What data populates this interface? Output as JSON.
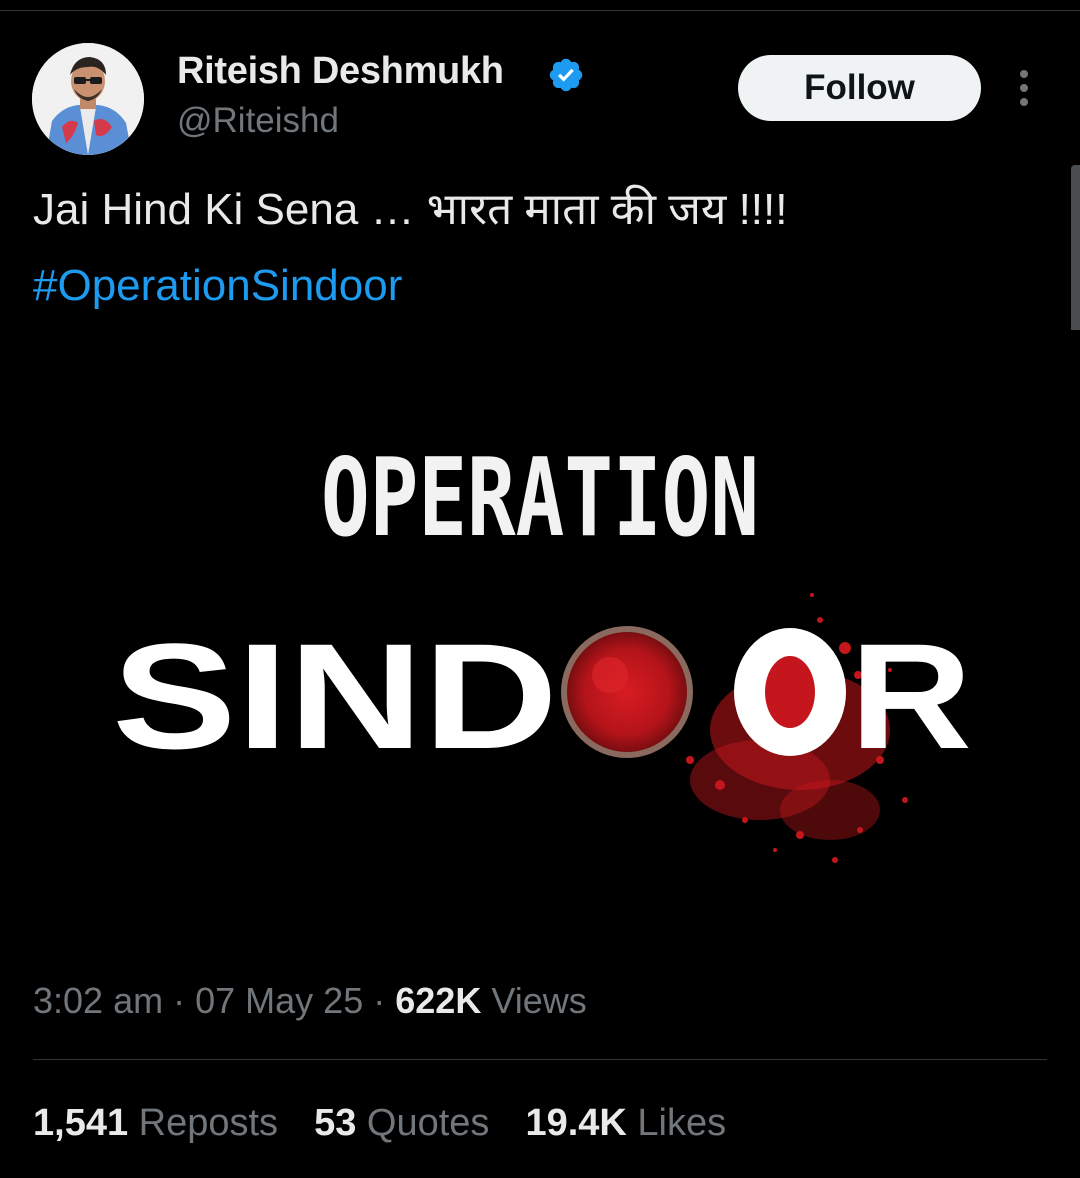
{
  "colors": {
    "background": "#000000",
    "text_primary": "#e7e9ea",
    "text_secondary": "#71767b",
    "link": "#1d9bf0",
    "verified": "#1d9bf0",
    "follow_bg": "#eff3f4",
    "sindoor_red": "#d4191f"
  },
  "author": {
    "display_name": "Riteish Deshmukh",
    "handle": "@Riteishd",
    "verified_icon": "verified-badge-icon",
    "avatar": "profile-photo"
  },
  "actions": {
    "follow_label": "Follow",
    "more_icon": "more-options-icon"
  },
  "tweet": {
    "text": "Jai Hind Ki Sena … भारत माता की जय !!!!",
    "hashtag": "#OperationSindoor"
  },
  "media": {
    "line1": "OPERATION",
    "line2_left": "SIND",
    "line2_right": "R"
  },
  "meta": {
    "time": "3:02 am",
    "separator": "·",
    "date": "07 May 25",
    "views_count": "622K",
    "views_label": "Views"
  },
  "stats": {
    "reposts_count": "1,541",
    "reposts_label": "Reposts",
    "quotes_count": "53",
    "quotes_label": "Quotes",
    "likes_count": "19.4K",
    "likes_label": "Likes"
  }
}
